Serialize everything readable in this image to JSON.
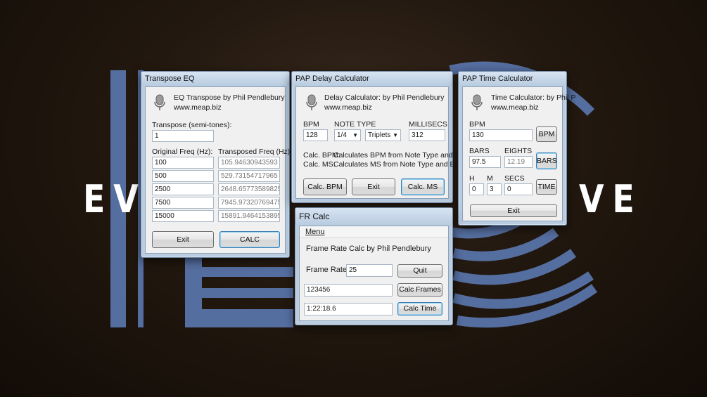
{
  "background": {
    "logo_left": "EV",
    "logo_right": "VE",
    "accent": "#5b78b0"
  },
  "transpose_eq": {
    "title": "Transpose EQ",
    "heading": "EQ Transpose  by Phil Pendlebury",
    "website": "www.meap.biz",
    "transpose_label": "Transpose (semi-tones):",
    "transpose_value": "1",
    "orig_label": "Original Freq (Hz):",
    "trans_label": "Transposed Freq (Hz):",
    "rows": [
      {
        "orig": "100",
        "trans": "105.94630943593"
      },
      {
        "orig": "500",
        "trans": "529.73154717965"
      },
      {
        "orig": "2500",
        "trans": "2648.65773589825"
      },
      {
        "orig": "7500",
        "trans": "7945.97320769475"
      },
      {
        "orig": "15000",
        "trans": "15891.9464153895"
      }
    ],
    "exit_label": "Exit",
    "calc_label": "CALC"
  },
  "delay_calc": {
    "title": "PAP Delay Calculator",
    "heading": "Delay Calculator: by Phil Pendlebury",
    "website": "www.meap.biz",
    "bpm_label": "BPM",
    "bpm_value": "128",
    "note_type_label": "NOTE TYPE",
    "note_value": "1/4",
    "note_mode": "Triplets",
    "ms_label": "MILLISECS",
    "ms_value": "312",
    "help_bpm_key": "Calc. BPM:",
    "help_bpm_text": "Calculates BPM from Note Type and MS",
    "help_ms_key": "Calc. MS:",
    "help_ms_text": "Calculates MS from Note Type and BPM",
    "calc_bpm_label": "Calc. BPM",
    "exit_label": "Exit",
    "calc_ms_label": "Calc. MS"
  },
  "time_calc": {
    "title": "PAP Time Calculator",
    "heading": "Time Calculator: by Phil P",
    "website": "www.meap.biz",
    "bpm_label": "BPM",
    "bpm_value": "130",
    "bpm_button": "BPM",
    "bars_label": "BARS",
    "bars_value": "97.5",
    "eights_label": "EIGHTS",
    "eights_value": "12.19",
    "bars_button": "BARS",
    "h_label": "H",
    "h_value": "0",
    "m_label": "M",
    "m_value": "3",
    "secs_label": "SECS",
    "secs_value": "0",
    "time_button": "TIME",
    "exit_label": "Exit"
  },
  "fr_calc": {
    "title": "FR Calc",
    "menu_label": "Menu",
    "heading": "Frame Rate Calc by Phil Pendlebury",
    "frame_rate_label": "Frame Rate:",
    "frame_rate_value": "25",
    "quit_label": "Quit",
    "frames_value": "123456",
    "calc_frames_label": "Calc Frames",
    "time_value": "1:22:18.6",
    "calc_time_label": "Calc Time"
  }
}
